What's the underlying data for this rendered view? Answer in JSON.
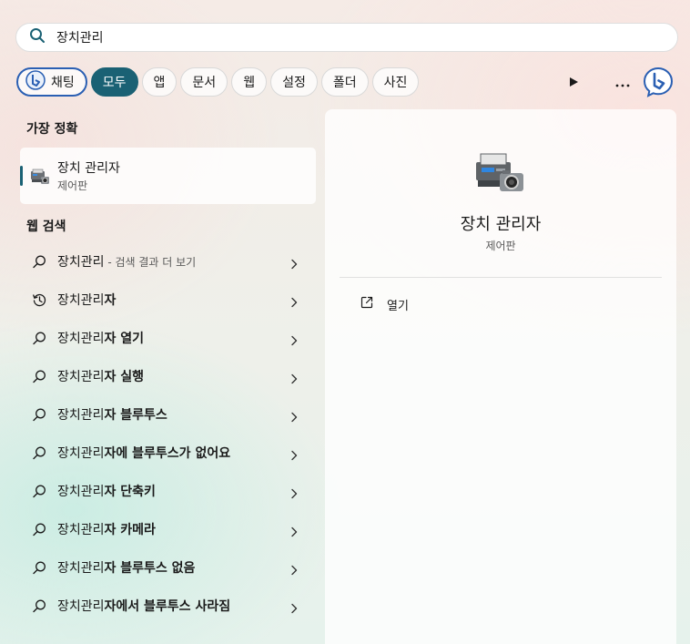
{
  "search": {
    "query": "장치관리"
  },
  "filters": {
    "chat_label": "채팅",
    "items": [
      "모두",
      "앱",
      "문서",
      "웹",
      "설정",
      "폴더",
      "사진"
    ],
    "active_index": 0
  },
  "best_match": {
    "heading": "가장 정확",
    "title": "장치 관리자",
    "subtitle": "제어판"
  },
  "web_search": {
    "heading": "웹 검색",
    "items": [
      {
        "prefix": "장치관리",
        "bold": "",
        "suffix": " - 검색 결과 더 보기",
        "icon": "search-icon"
      },
      {
        "prefix": "장치관리",
        "bold": "자",
        "suffix": "",
        "icon": "history-icon"
      },
      {
        "prefix": "장치관리",
        "bold": "자 열기",
        "suffix": "",
        "icon": "search-icon"
      },
      {
        "prefix": "장치관리",
        "bold": "자 실행",
        "suffix": "",
        "icon": "search-icon"
      },
      {
        "prefix": "장치관리",
        "bold": "자 블루투스",
        "suffix": "",
        "icon": "search-icon"
      },
      {
        "prefix": "장치관리",
        "bold": "자에 블루투스가 없어요",
        "suffix": "",
        "icon": "search-icon"
      },
      {
        "prefix": "장치관리",
        "bold": "자 단축키",
        "suffix": "",
        "icon": "search-icon"
      },
      {
        "prefix": "장치관리",
        "bold": "자 카메라",
        "suffix": "",
        "icon": "search-icon"
      },
      {
        "prefix": "장치관리",
        "bold": "자 블루투스 없음",
        "suffix": "",
        "icon": "search-icon"
      },
      {
        "prefix": "장치관리",
        "bold": "자에서 블루투스 사라짐",
        "suffix": "",
        "icon": "search-icon"
      }
    ]
  },
  "preview": {
    "title": "장치 관리자",
    "subtitle": "제어판",
    "action_open": "열기"
  },
  "colors": {
    "accent": "#1a6174",
    "bing_blue": "#2a5fb3"
  }
}
